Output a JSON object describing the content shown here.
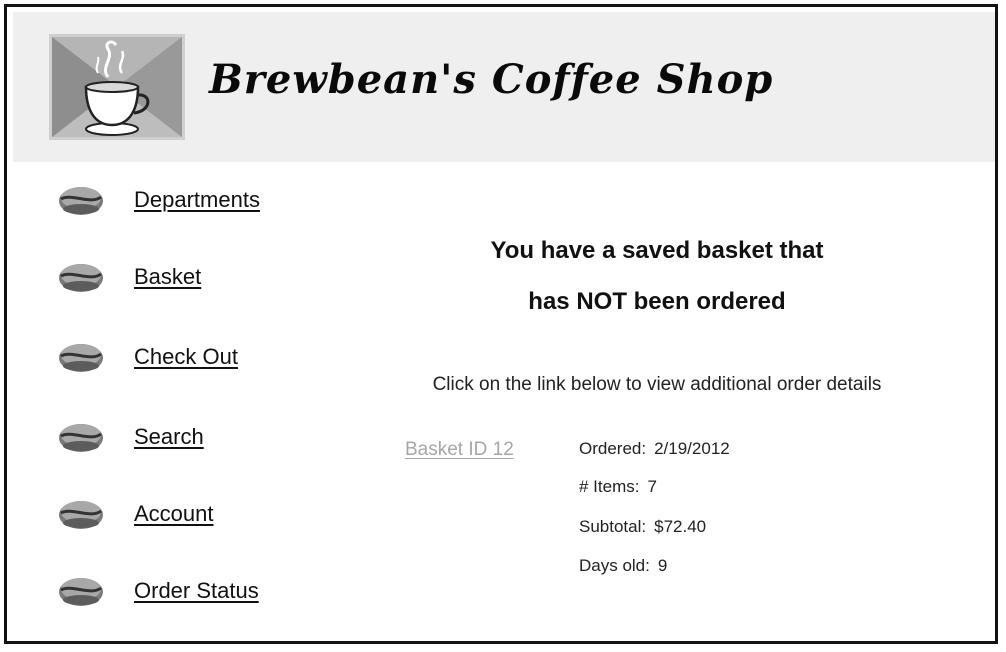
{
  "header": {
    "title": "Brewbean's Coffee Shop",
    "logo_icon": "coffee-cup-icon"
  },
  "sidebar": {
    "items": [
      {
        "label": "Departments",
        "icon": "coffee-bean-icon"
      },
      {
        "label": "Basket",
        "icon": "coffee-bean-icon"
      },
      {
        "label": "Check Out",
        "icon": "coffee-bean-icon"
      },
      {
        "label": "Search",
        "icon": "coffee-bean-icon"
      },
      {
        "label": "Account",
        "icon": "coffee-bean-icon"
      },
      {
        "label": "Order Status",
        "icon": "coffee-bean-icon"
      }
    ]
  },
  "main": {
    "heading_line1": "You have a saved basket that",
    "heading_line2": "has NOT been ordered",
    "instructions": "Click on the link below to view additional order details",
    "basket_link": "Basket ID 12",
    "details": {
      "ordered_label": "Ordered:",
      "ordered_value": "2/19/2012",
      "items_label": "# Items:",
      "items_value": "7",
      "subtotal_label": "Subtotal:",
      "subtotal_value": "$72.40",
      "days_label": "Days old:",
      "days_value": "9"
    }
  },
  "colors": {
    "header_bg": "#efefef",
    "link_text": "#111111",
    "basket_link_text": "#a6a6a6"
  }
}
